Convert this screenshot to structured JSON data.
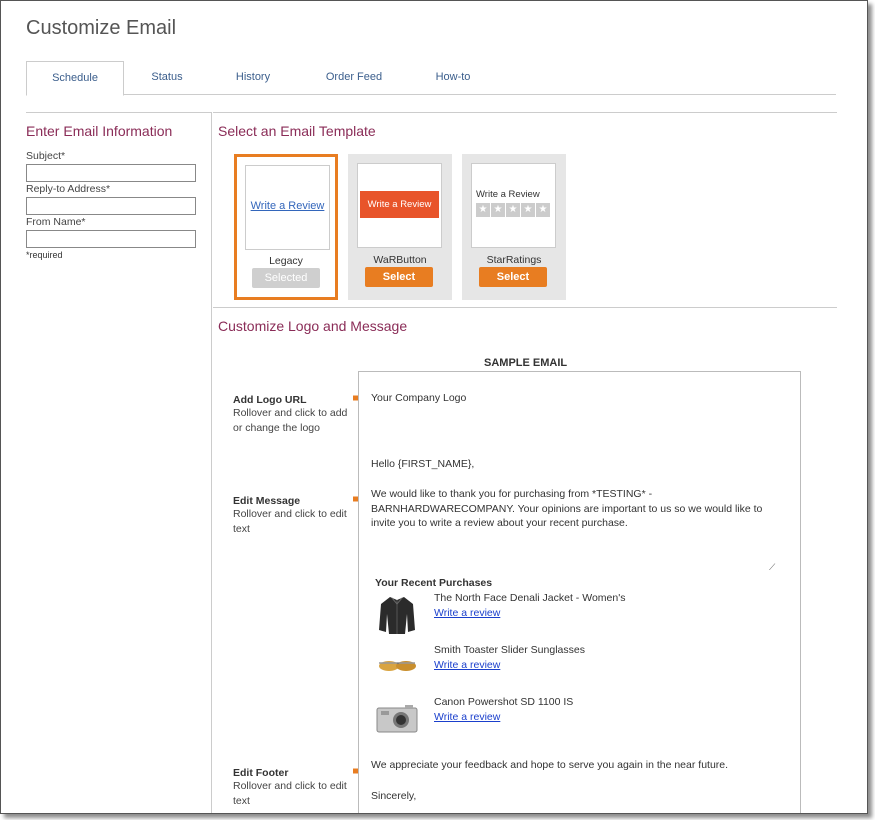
{
  "page": {
    "title": "Customize Email"
  },
  "tabs": [
    {
      "label": "Schedule",
      "active": true
    },
    {
      "label": "Status"
    },
    {
      "label": "History"
    },
    {
      "label": "Order Feed"
    },
    {
      "label": "How-to"
    }
  ],
  "email_info": {
    "heading": "Enter Email Information",
    "subject_label": "Subject*",
    "subject_value": "",
    "reply_to_label": "Reply-to Address*",
    "reply_to_value": "",
    "from_name_label": "From Name*",
    "from_name_value": "",
    "required_note": "*required"
  },
  "templates": {
    "heading": "Select an Email Template",
    "items": [
      {
        "name": "Legacy",
        "preview_text": "Write a Review",
        "button": "Selected",
        "selected": true
      },
      {
        "name": "WaRButton",
        "preview_text": "Write a Review",
        "button": "Select",
        "selected": false
      },
      {
        "name": "StarRatings",
        "preview_text": "Write a Review",
        "button": "Select",
        "selected": false
      }
    ]
  },
  "customize": {
    "heading": "Customize Logo and Message",
    "instructions": [
      {
        "title": "Add Logo URL",
        "desc": "Rollover and click to add or change the logo"
      },
      {
        "title": "Edit Message",
        "desc": "Rollover and click to edit text"
      },
      {
        "title": "Edit Footer",
        "desc": "Rollover and click to edit text"
      }
    ]
  },
  "sample_email": {
    "label": "SAMPLE EMAIL",
    "logo_text": "Your Company Logo",
    "greeting": "Hello {FIRST_NAME},",
    "message": "We would like to thank you for purchasing from *TESTING* - BARNHARDWARECOMPANY.  Your opinions are important to us so we would like to invite you to write a review about your recent purchase.",
    "purchases_title": "Your Recent Purchases",
    "products": [
      {
        "name": "The North Face Denali Jacket - Women's",
        "link": "Write a review",
        "icon": "jacket-icon"
      },
      {
        "name": "Smith Toaster Slider Sunglasses",
        "link": "Write a review",
        "icon": "sunglasses-icon"
      },
      {
        "name": "Canon Powershot SD 1100 IS",
        "link": "Write a review",
        "icon": "camera-icon"
      }
    ],
    "footer": "We appreciate your feedback and hope to serve you again in the near future.",
    "signoff": "Sincerely,"
  },
  "colors": {
    "accent_orange": "#e87d21",
    "heading_maroon": "#8a2c57",
    "tab_blue": "#3b5e8c",
    "link_blue": "#1a3fcc"
  }
}
